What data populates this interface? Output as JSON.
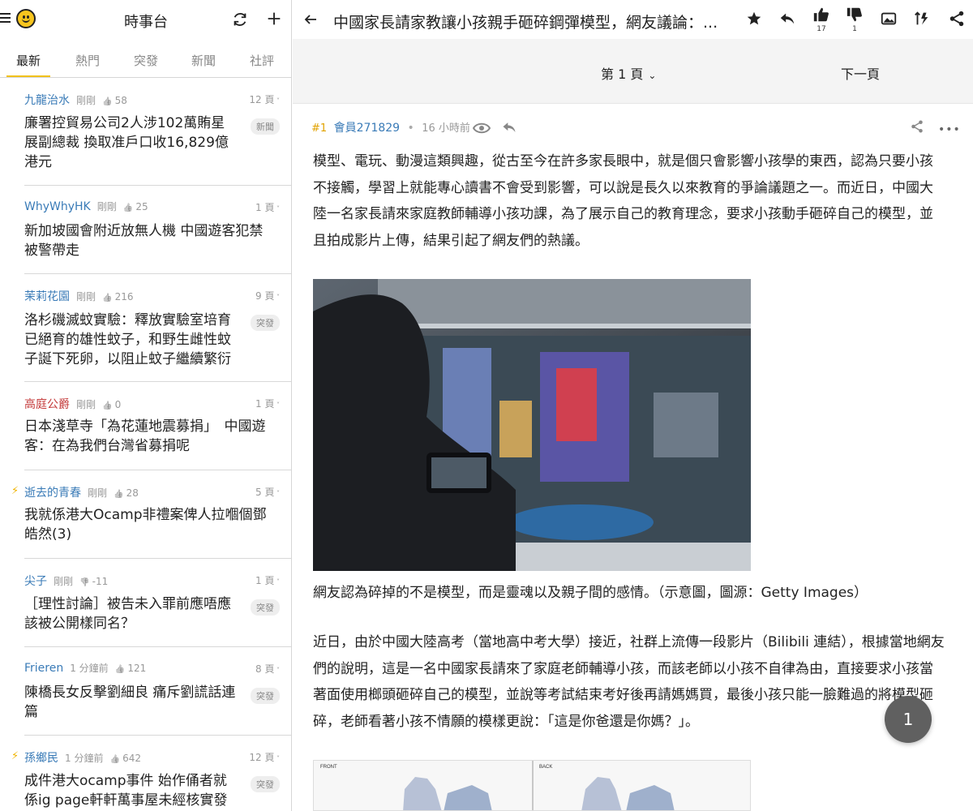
{
  "app": {
    "title": "時事台"
  },
  "tabs": [
    {
      "label": "最新"
    },
    {
      "label": "熱門"
    },
    {
      "label": "突發"
    },
    {
      "label": "新聞"
    },
    {
      "label": "社評"
    }
  ],
  "topics": [
    {
      "author": "九龍治水",
      "time": "剛剛",
      "likes": "58",
      "pages": "12 頁",
      "title": "廉署控貿易公司2人涉102萬賄星展副總裁 換取准戶口收16,829億港元",
      "tag": "新聞",
      "hot": false,
      "author_color": "blue",
      "dislike": false
    },
    {
      "author": "WhyWhyHK",
      "time": "剛剛",
      "likes": "25",
      "pages": "1 頁",
      "title": "新加坡國會附近放無人機 中國遊客犯禁被警帶走",
      "tag": "",
      "hot": false,
      "author_color": "blue",
      "dislike": false
    },
    {
      "author": "茉莉花園",
      "time": "剛剛",
      "likes": "216",
      "pages": "9 頁",
      "title": "洛杉磯滅蚊實驗：釋放實驗室培育已絕育的雄性蚊子，和野生雌性蚊子誕下死卵，以阻止蚊子繼續繁衍",
      "tag": "突發",
      "hot": false,
      "author_color": "blue",
      "dislike": false
    },
    {
      "author": "高庭公爵",
      "time": "剛剛",
      "likes": "0",
      "pages": "1 頁",
      "title": "日本淺草寺「為花蓮地震募捐」　中國遊客：在為我們台灣省募捐呢",
      "tag": "",
      "hot": false,
      "author_color": "red",
      "dislike": false
    },
    {
      "author": "逝去的青春",
      "time": "剛剛",
      "likes": "28",
      "pages": "5 頁",
      "title": "我就係港大Ocamp非禮案俾人拉嗰個鄧皓然(3)",
      "tag": "",
      "hot": true,
      "author_color": "blue",
      "dislike": false
    },
    {
      "author": "尖子",
      "time": "剛剛",
      "likes": "-11",
      "pages": "1 頁",
      "title": "［理性討論］被告未入罪前應唔應該被公開樣同名？",
      "tag": "突發",
      "hot": false,
      "author_color": "blue",
      "dislike": true
    },
    {
      "author": "Frieren",
      "time": "1 分鐘前",
      "likes": "121",
      "pages": "8 頁",
      "title": "陳橋長女反擊劉細良 痛斥劉謊話連篇",
      "tag": "突發",
      "hot": false,
      "author_color": "blue",
      "dislike": false
    },
    {
      "author": "孫鄉民",
      "time": "1 分鐘前",
      "likes": "642",
      "pages": "12 頁",
      "title": "成件港大ocamp事件 始作俑者就係ig page軒軒萬事屋未經核實發",
      "tag": "突發",
      "hot": true,
      "author_color": "blue",
      "dislike": false
    }
  ],
  "post": {
    "title": "中國家長請家教讓小孩親手砸碎鋼彈模型，網友議論：...",
    "like_count": "17",
    "dislike_count": "1",
    "page_label": "第 1 頁",
    "next_page": "下一頁",
    "floor": "#1",
    "member": "會員271829",
    "time": "16 小時前",
    "para1": "模型、電玩、動漫這類興趣，從古至今在許多家長眼中，就是個只會影響小孩學的東西，認為只要小孩不接觸，學習上就能專心讀書不會受到影響，可以說是長久以來教育的爭論議題之一。而近日，中國大陸一名家長請來家庭教師輔導小孩功課，為了展示自己的教育理念，要求小孩動手砸碎自己的模型，並且拍成影片上傳，結果引起了網友們的熱議。",
    "caption": "網友認為碎掉的不是模型，而是靈魂以及親子間的感情。（示意圖，圖源：Getty Images）",
    "para2": "近日，由於中國大陸高考（當地高中考大學）接近，社群上流傳一段影片（Bilibili 連結），根據當地網友們的說明，這是一名中國家長請來了家庭老師輔導小孩，而該老師以小孩不自律為由，直接要求小孩當著面使用榔頭砸碎自己的模型，並說等考試結束考好後再請媽媽買，最後小孩只能一臉難過的將模型砸碎，老師看著小孩不情願的模樣更說：「這是你爸還是你媽？」。",
    "img2_front": "FRONT",
    "img2_back": "BACK",
    "float_page": "1"
  },
  "colors": {
    "accent": "#f2c21b",
    "author": "#3a7bb7",
    "author_red": "#c43a3a",
    "floor": "#e1a200"
  }
}
